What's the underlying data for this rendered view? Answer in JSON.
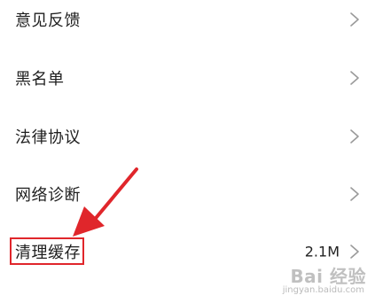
{
  "menu": {
    "items": [
      {
        "label": "意见反馈",
        "value": ""
      },
      {
        "label": "黑名单",
        "value": ""
      },
      {
        "label": "法律协议",
        "value": ""
      },
      {
        "label": "网络诊断",
        "value": ""
      },
      {
        "label": "清理缓存",
        "value": "2.1M"
      }
    ],
    "partial_next_label": "..."
  },
  "annotation": {
    "color": "#e0262b",
    "target": "清理缓存"
  },
  "watermark": {
    "brand": "Bai 经验",
    "url": "jingyan.baidu.com"
  },
  "icons": {
    "chevron": "chevron-right-icon",
    "arrow": "annotation-arrow"
  }
}
